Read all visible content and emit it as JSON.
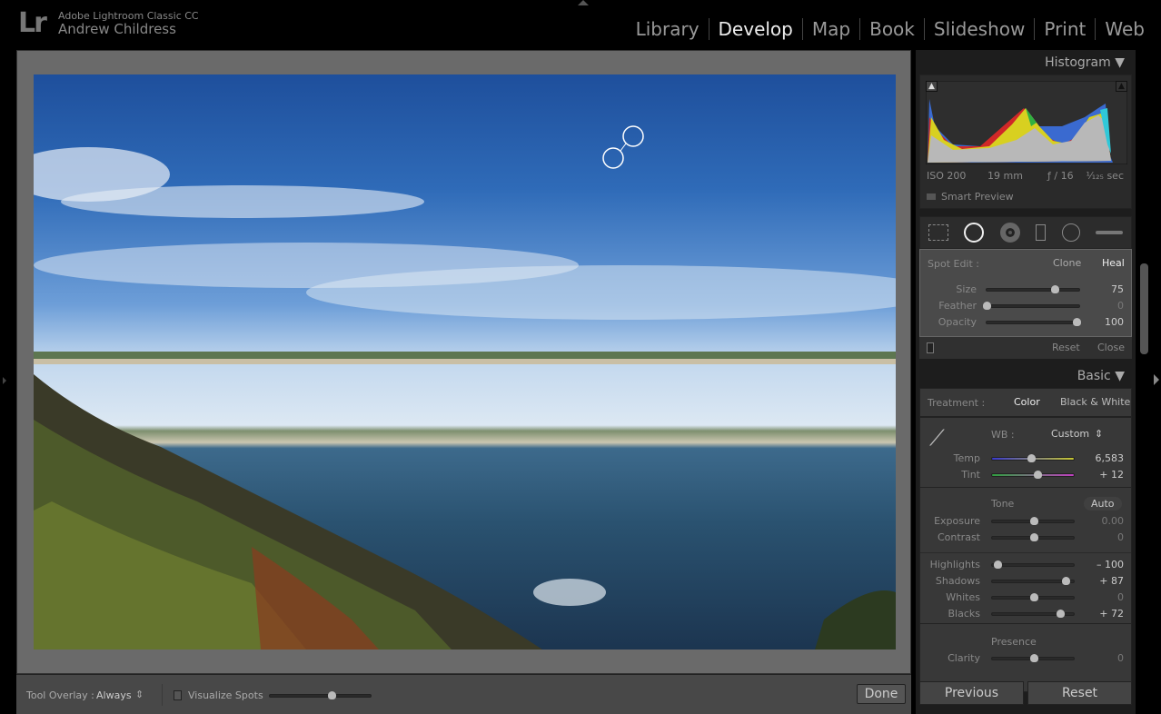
{
  "app": {
    "product": "Adobe Lightroom Classic CC",
    "user": "Andrew Childress",
    "logo": "Lr"
  },
  "modules": [
    {
      "label": "Library"
    },
    {
      "label": "Develop",
      "active": true
    },
    {
      "label": "Map"
    },
    {
      "label": "Book"
    },
    {
      "label": "Slideshow"
    },
    {
      "label": "Print"
    },
    {
      "label": "Web"
    }
  ],
  "histogram": {
    "title": "Histogram",
    "iso": "ISO 200",
    "focal": "19 mm",
    "aperture": "ƒ / 16",
    "shutter": "¹⁄₁₂₅ sec",
    "smart_preview": "Smart Preview"
  },
  "tools": [
    "crop-overlay-icon",
    "spot-removal-icon",
    "red-eye-icon",
    "graduated-filter-icon",
    "radial-filter-icon",
    "adjustment-brush-icon"
  ],
  "spot_edit": {
    "label": "Spot Edit :",
    "clone": "Clone",
    "heal": "Heal",
    "active": "Heal",
    "sliders": [
      {
        "label": "Size",
        "value": "75",
        "pos": 0.72
      },
      {
        "label": "Feather",
        "value": "0",
        "pos": 0.0,
        "dim": true
      },
      {
        "label": "Opacity",
        "value": "100",
        "pos": 0.95
      }
    ],
    "reset": "Reset",
    "close": "Close"
  },
  "basic": {
    "title": "Basic",
    "treatment_label": "Treatment :",
    "color": "Color",
    "bw": "Black & White",
    "wb_label": "WB :",
    "wb_value": "Custom",
    "wb_sliders": [
      {
        "label": "Temp",
        "value": "6,583",
        "pos": 0.47
      },
      {
        "label": "Tint",
        "value": "+ 12",
        "pos": 0.54
      }
    ],
    "tone_label": "Tone",
    "auto": "Auto",
    "tone_sliders": [
      {
        "label": "Exposure",
        "value": "0.00",
        "pos": 0.5,
        "dim": true
      },
      {
        "label": "Contrast",
        "value": "0",
        "pos": 0.5,
        "dim": true
      }
    ],
    "tone_sliders2": [
      {
        "label": "Highlights",
        "value": "– 100",
        "pos": 0.06
      },
      {
        "label": "Shadows",
        "value": "+ 87",
        "pos": 0.88
      },
      {
        "label": "Whites",
        "value": "0",
        "pos": 0.5,
        "dim": true
      },
      {
        "label": "Blacks",
        "value": "+ 72",
        "pos": 0.81
      }
    ],
    "presence_label": "Presence",
    "presence_sliders": [
      {
        "label": "Clarity",
        "value": "0",
        "pos": 0.5,
        "dim": true
      }
    ]
  },
  "footer": {
    "previous": "Previous",
    "reset": "Reset"
  },
  "toolbar": {
    "overlay_label": "Tool Overlay :",
    "overlay_value": "Always",
    "visualize": "Visualize Spots",
    "visualize_checked": false,
    "visualize_threshold": 0.6,
    "done": "Done"
  }
}
